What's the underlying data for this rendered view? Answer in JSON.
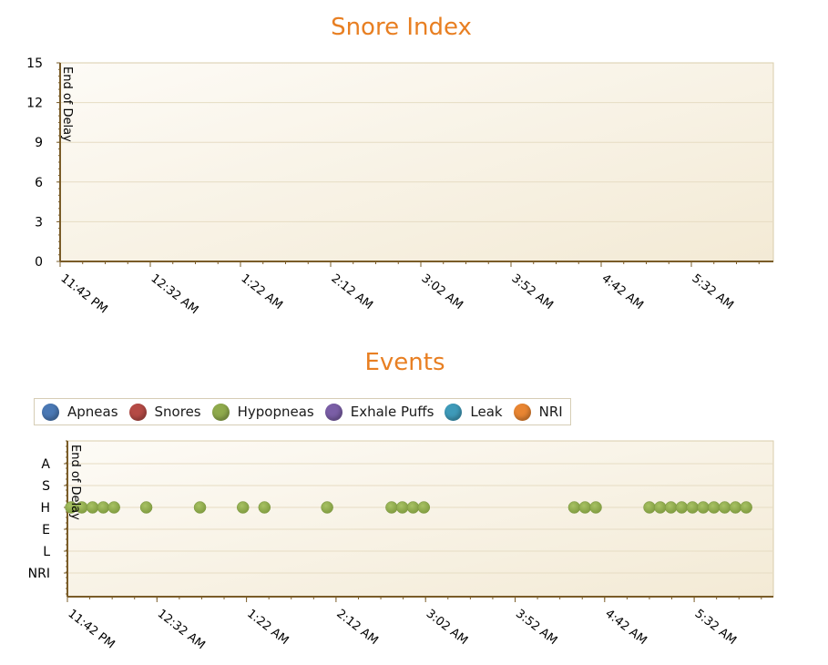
{
  "chart_data": [
    {
      "type": "line",
      "title": "Snore Index",
      "y_ticks": [
        "15",
        "12",
        "9",
        "6",
        "3",
        "0"
      ],
      "ylim": [
        0,
        15
      ],
      "x_ticks": [
        "11:42 PM",
        "12:32 AM",
        "1:22 AM",
        "2:12 AM",
        "3:02 AM",
        "3:52 AM",
        "4:42 AM",
        "5:32 AM"
      ],
      "annotation": "End of Delay",
      "series": [],
      "grid": true
    },
    {
      "type": "scatter",
      "title": "Events",
      "y_categories": [
        "A",
        "S",
        "H",
        "E",
        "L",
        "NRI"
      ],
      "x_ticks": [
        "11:42 PM",
        "12:32 AM",
        "1:22 AM",
        "2:12 AM",
        "3:02 AM",
        "3:52 AM",
        "4:42 AM",
        "5:32 AM"
      ],
      "annotation": "End of Delay",
      "legend": [
        {
          "name": "Apneas",
          "color": "#4a78b4"
        },
        {
          "name": "Snores",
          "color": "#b54a45"
        },
        {
          "name": "Hypopneas",
          "color": "#8faa4c"
        },
        {
          "name": "Exhale Puffs",
          "color": "#7a5ea6"
        },
        {
          "name": "Leak",
          "color": "#3e9ab9"
        },
        {
          "name": "NRI",
          "color": "#e88532"
        }
      ],
      "legend_position": "top",
      "grid": true,
      "series": [
        {
          "name": "Hypopneas",
          "category": "H",
          "color": "#8faa4c",
          "x_minutes": [
            0,
            6,
            12,
            18,
            24,
            42,
            72,
            96,
            108,
            143,
            179,
            185,
            191,
            197,
            281,
            287,
            293,
            323,
            329,
            335,
            341,
            347,
            353,
            359,
            365,
            371,
            377
          ]
        }
      ]
    }
  ]
}
